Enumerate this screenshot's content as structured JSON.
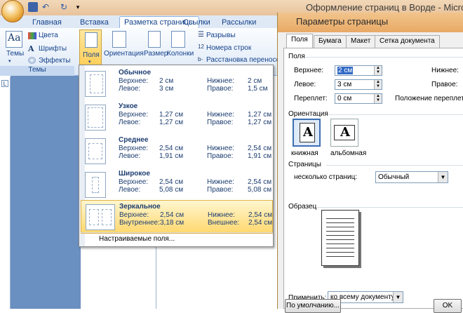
{
  "window": {
    "title": "Оформление страниц в Ворде - Microsoft"
  },
  "ribbon_tabs": [
    "Главная",
    "Вставка",
    "Разметка страницы",
    "Ссылки",
    "Рассылки"
  ],
  "themes_group": {
    "big_button": "Темы",
    "colors": "Цвета",
    "fonts": "Шрифты",
    "effects": "Эффекты",
    "group_label": "Темы"
  },
  "page_setup": {
    "fields": "Поля",
    "orientation": "Ориентация",
    "size": "Размер",
    "columns": "Колонки",
    "breaks": "Разрывы",
    "line_numbers": "Номера строк",
    "hyphenation": "Расстановка переносов"
  },
  "margins_menu": {
    "options": [
      {
        "name": "Обычное",
        "top_label": "Верхнее:",
        "top": "2 см",
        "bottom_label": "Нижнее:",
        "bottom": "2 см",
        "left_label": "Левое:",
        "left": "3 см",
        "right_label": "Правое:",
        "right": "1,5 см"
      },
      {
        "name": "Узкое",
        "top_label": "Верхнее:",
        "top": "1,27 см",
        "bottom_label": "Нижнее:",
        "bottom": "1,27 см",
        "left_label": "Левое:",
        "left": "1,27 см",
        "right_label": "Правое:",
        "right": "1,27 см"
      },
      {
        "name": "Среднее",
        "top_label": "Верхнее:",
        "top": "2,54 см",
        "bottom_label": "Нижнее:",
        "bottom": "2,54 см",
        "left_label": "Левое:",
        "left": "1,91 см",
        "right_label": "Правое:",
        "right": "1,91 см"
      },
      {
        "name": "Широкое",
        "top_label": "Верхнее:",
        "top": "2,54 см",
        "bottom_label": "Нижнее:",
        "bottom": "2,54 см",
        "left_label": "Левое:",
        "left": "5,08 см",
        "right_label": "Правое:",
        "right": "5,08 см"
      },
      {
        "name": "Зеркальное",
        "top_label": "Верхнее:",
        "top": "2,54 см",
        "bottom_label": "Нижнее:",
        "bottom": "2,54 см",
        "left_label": "Внутреннее:",
        "left": "3,18 см",
        "right_label": "Внешнее:",
        "right": "2,54 см"
      }
    ],
    "custom": "Настраиваемые поля..."
  },
  "dialog": {
    "title": "Параметры страницы",
    "tabs": [
      "Поля",
      "Бумага",
      "Макет",
      "Сетка документа"
    ],
    "margins_section": "Поля",
    "top_label": "Верхнее:",
    "top_value": "2 см",
    "left_label": "Левое:",
    "left_value": "3 см",
    "gutter_label": "Переплет:",
    "gutter_value": "0 см",
    "bottom_label": "Нижнее:",
    "right_label": "Правое:",
    "gutter_pos_label": "Положение переплета:",
    "orientation_section": "Ориентация",
    "portrait": "книжная",
    "landscape": "альбомная",
    "pages_section": "Страницы",
    "multiple_pages_label": "несколько страниц:",
    "multiple_pages_value": "Обычный",
    "preview_section": "Образец",
    "apply_label": "Применить:",
    "apply_value": "ко всему документу",
    "default_button": "По умолчанию...",
    "ok_button": "OK"
  },
  "colors": {
    "ribbon_text": "#15428b",
    "accent": "#ffd86e",
    "doc_bg": "#6a8fc1"
  }
}
